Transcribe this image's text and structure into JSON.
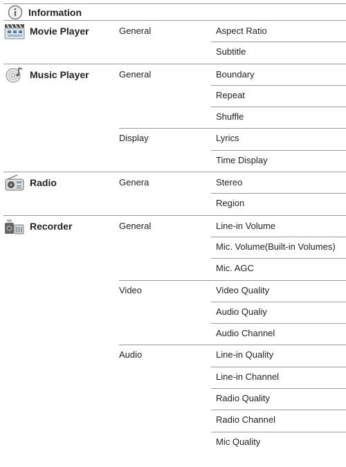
{
  "sections": {
    "information": {
      "title": "Information",
      "icon": "info-circle-icon"
    },
    "movie": {
      "title": "Movie Player",
      "icon": "clapperboard-icon",
      "group": "General",
      "items": [
        "Aspect Ratio",
        "Subtitle"
      ]
    },
    "music": {
      "title": "Music Player",
      "icon": "music-cd-icon",
      "groups": [
        {
          "label": "General",
          "items": [
            "Boundary",
            "Repeat",
            "Shuffle"
          ]
        },
        {
          "label": "Display",
          "items": [
            "Lyrics",
            "Time Display"
          ]
        }
      ]
    },
    "radio": {
      "title": "Radio",
      "icon": "radio-icon",
      "group": "Genera",
      "items": [
        "Stereo",
        "Region"
      ]
    },
    "recorder": {
      "title": "Recorder",
      "icon": "recorder-icon",
      "groups": [
        {
          "label": "General",
          "items": [
            "Line-in Volume",
            "Mic. Volume(Built-in Volumes)",
            "Mic. AGC"
          ]
        },
        {
          "label": "Video",
          "items": [
            "Video Quality",
            "Audio Qualiy",
            "Audio Channel"
          ]
        },
        {
          "label": "Audio",
          "items": [
            "Line-in Quality",
            "Line-in Channel",
            "Radio Quality",
            "Radio Channel",
            "Mic Quality"
          ]
        }
      ]
    }
  }
}
